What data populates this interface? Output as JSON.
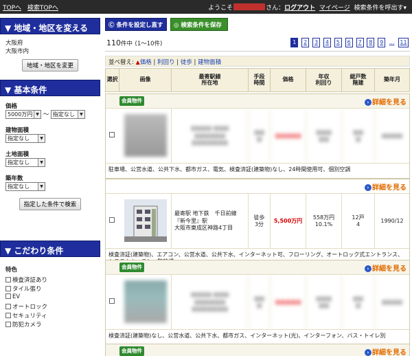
{
  "topbar": {
    "links": [
      "TOPへ",
      "検索TOPへ"
    ],
    "welcome_prefix": "ようこそ",
    "welcome_suffix": "さん：",
    "logout": "ログアウト",
    "mypage": "マイページ",
    "recall": "検索条件を呼出す▾"
  },
  "sidebar": {
    "area": {
      "title": "▼ 地域・地区を変える",
      "pref": "大阪府",
      "city": "大阪市内",
      "button": "地域・地区を変更"
    },
    "basic": {
      "title": "▼ 基本条件",
      "price_label": "価格",
      "price_min": "5000万円",
      "tilde": "～",
      "price_max": "指定なし",
      "building_area_label": "建物面積",
      "building_area_value": "指定なし",
      "land_area_label": "土地面積",
      "land_area_value": "指定なし",
      "age_label": "築年数",
      "age_value": "指定なし",
      "search_button": "指定した条件で検索"
    },
    "kodawari": {
      "title": "▼ こだわり条件",
      "section": "特色",
      "items": [
        "検査済証あり",
        "タイル張り",
        "EV",
        "オートロック",
        "セキュリティ",
        "防犯カメラ"
      ]
    }
  },
  "main": {
    "reset_button": "条件を設定し直す",
    "save_button": "検索条件を保存",
    "count": "110",
    "count_unit": "件中",
    "count_range": "(1～10件)",
    "pages": [
      "1",
      "2",
      "3",
      "4",
      "5",
      "6",
      "7",
      "8",
      "9",
      "...",
      "11"
    ],
    "sort": {
      "label": "並べ替え:",
      "options": [
        "価格",
        "利回り",
        "徒歩",
        "建物面積"
      ]
    },
    "columns": [
      "選択",
      "画像",
      "最寄駅線\n所在地",
      "手段\n時間",
      "価格",
      "年収\n利回り",
      "総戸数\n階建",
      "築年月"
    ],
    "badge": "会員物件",
    "detail": "詳細を見る",
    "listings": [
      {
        "member": true,
        "blurred": true,
        "features": "駐車場、公営水道、公共下水、都市ガス、電気、検査済証(建築物)なし、24時間使用可、個別空調"
      },
      {
        "member": false,
        "blurred": false,
        "station": "最寄駅 地下鉄　千日前線",
        "station2": "『新今里』駅",
        "address": "大阪市東成区神路4丁目",
        "walk": "徒歩\n3分",
        "price": "5,500万円",
        "income": "558万円",
        "yield": "10.1%",
        "units": "12戸",
        "floors": "4",
        "built": "1990/12",
        "features": "検査済証(建築物)、エアコン、公営水道、公共下水、インターネット可、フローリング、オートロック式エントランス、システムキッチン、駐輪場"
      },
      {
        "member": true,
        "blurred": true,
        "features": "検査済証(建築物)なし、公営水道、公共下水、都市ガス、インターネット(光)、インターフォン、バス・トイレ別"
      },
      {
        "member": true,
        "blurred": true,
        "features": ""
      }
    ]
  },
  "colors": {
    "nav_blue": "#1f2e9c",
    "save_green": "#3a8f2a",
    "badge_green": "#2f8a2f",
    "detail_orange": "#e26b00",
    "price_red": "#d40000",
    "header_beige": "#f4f0dc"
  }
}
